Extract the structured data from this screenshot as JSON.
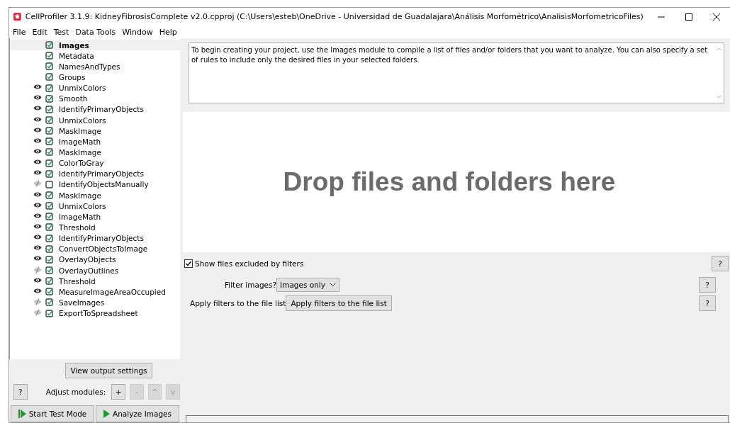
{
  "window": {
    "title": "CellProfiler 3.1.9: KidneyFibrosisComplete v2.0.cpproj (C:\\Users\\esteb\\OneDrive - Universidad de Guadalajara\\Análisis Morfométrico\\AnalisisMorfometricoFiles)"
  },
  "menu": [
    "File",
    "Edit",
    "Test",
    "Data Tools",
    "Window",
    "Help"
  ],
  "modules": [
    {
      "name": "Images",
      "display_toggle": false,
      "checked": true,
      "selected": true
    },
    {
      "name": "Metadata",
      "display_toggle": false,
      "checked": true,
      "selected": false
    },
    {
      "name": "NamesAndTypes",
      "display_toggle": false,
      "checked": true,
      "selected": false
    },
    {
      "name": "Groups",
      "display_toggle": false,
      "checked": true,
      "selected": false
    },
    {
      "name": "UnmixColors",
      "display_toggle": true,
      "display_on": true,
      "checked": true,
      "selected": false
    },
    {
      "name": "Smooth",
      "display_toggle": true,
      "display_on": true,
      "checked": true,
      "selected": false
    },
    {
      "name": "IdentifyPrimaryObjects",
      "display_toggle": true,
      "display_on": true,
      "checked": true,
      "selected": false
    },
    {
      "name": "UnmixColors",
      "display_toggle": true,
      "display_on": true,
      "checked": true,
      "selected": false
    },
    {
      "name": "MaskImage",
      "display_toggle": true,
      "display_on": true,
      "checked": true,
      "selected": false
    },
    {
      "name": "ImageMath",
      "display_toggle": true,
      "display_on": true,
      "checked": true,
      "selected": false
    },
    {
      "name": "MaskImage",
      "display_toggle": true,
      "display_on": true,
      "checked": true,
      "selected": false
    },
    {
      "name": "ColorToGray",
      "display_toggle": true,
      "display_on": true,
      "checked": true,
      "selected": false
    },
    {
      "name": "IdentifyPrimaryObjects",
      "display_toggle": true,
      "display_on": true,
      "checked": true,
      "selected": false
    },
    {
      "name": "IdentifyObjectsManually",
      "display_toggle": true,
      "display_on": false,
      "checked": false,
      "selected": false
    },
    {
      "name": "MaskImage",
      "display_toggle": true,
      "display_on": true,
      "checked": true,
      "selected": false
    },
    {
      "name": "UnmixColors",
      "display_toggle": true,
      "display_on": true,
      "checked": true,
      "selected": false
    },
    {
      "name": "ImageMath",
      "display_toggle": true,
      "display_on": true,
      "checked": true,
      "selected": false
    },
    {
      "name": "Threshold",
      "display_toggle": true,
      "display_on": true,
      "checked": true,
      "selected": false
    },
    {
      "name": "IdentifyPrimaryObjects",
      "display_toggle": true,
      "display_on": true,
      "checked": true,
      "selected": false
    },
    {
      "name": "ConvertObjectsToImage",
      "display_toggle": true,
      "display_on": true,
      "checked": true,
      "selected": false
    },
    {
      "name": "OverlayObjects",
      "display_toggle": true,
      "display_on": true,
      "checked": true,
      "selected": false
    },
    {
      "name": "OverlayOutlines",
      "display_toggle": true,
      "display_on": false,
      "checked": true,
      "selected": false
    },
    {
      "name": "Threshold",
      "display_toggle": true,
      "display_on": true,
      "checked": true,
      "selected": false
    },
    {
      "name": "MeasureImageAreaOccupied",
      "display_toggle": true,
      "display_on": true,
      "checked": true,
      "selected": false
    },
    {
      "name": "SaveImages",
      "display_toggle": true,
      "display_on": false,
      "checked": true,
      "selected": false
    },
    {
      "name": "ExportToSpreadsheet",
      "display_toggle": true,
      "display_on": false,
      "checked": true,
      "selected": false
    }
  ],
  "view_output_button": "View output settings",
  "help_button": "?",
  "adjust_label": "Adjust modules:",
  "adjust_buttons": [
    {
      "label": "+",
      "disabled": false
    },
    {
      "label": "-",
      "disabled": true
    },
    {
      "label": "^",
      "disabled": true
    },
    {
      "label": "v",
      "disabled": true
    }
  ],
  "test_mode_button": "Start Test Mode",
  "analyze_button": "Analyze Images",
  "help_text": "To begin creating your project, use the Images module to compile a list of files and/or folders that you want to analyze. You can also specify a set of rules to include only the desired files in your selected folders.",
  "drop_area": "Drop files and folders here",
  "show_excluded": {
    "label": "Show files excluded by filters",
    "checked": true,
    "help": "?"
  },
  "filter_images": {
    "label": "Filter images?",
    "value": "Images only",
    "help": "?"
  },
  "apply_filters": {
    "label": "Apply filters to the file list",
    "button": "Apply filters to the file list",
    "help": "?"
  }
}
